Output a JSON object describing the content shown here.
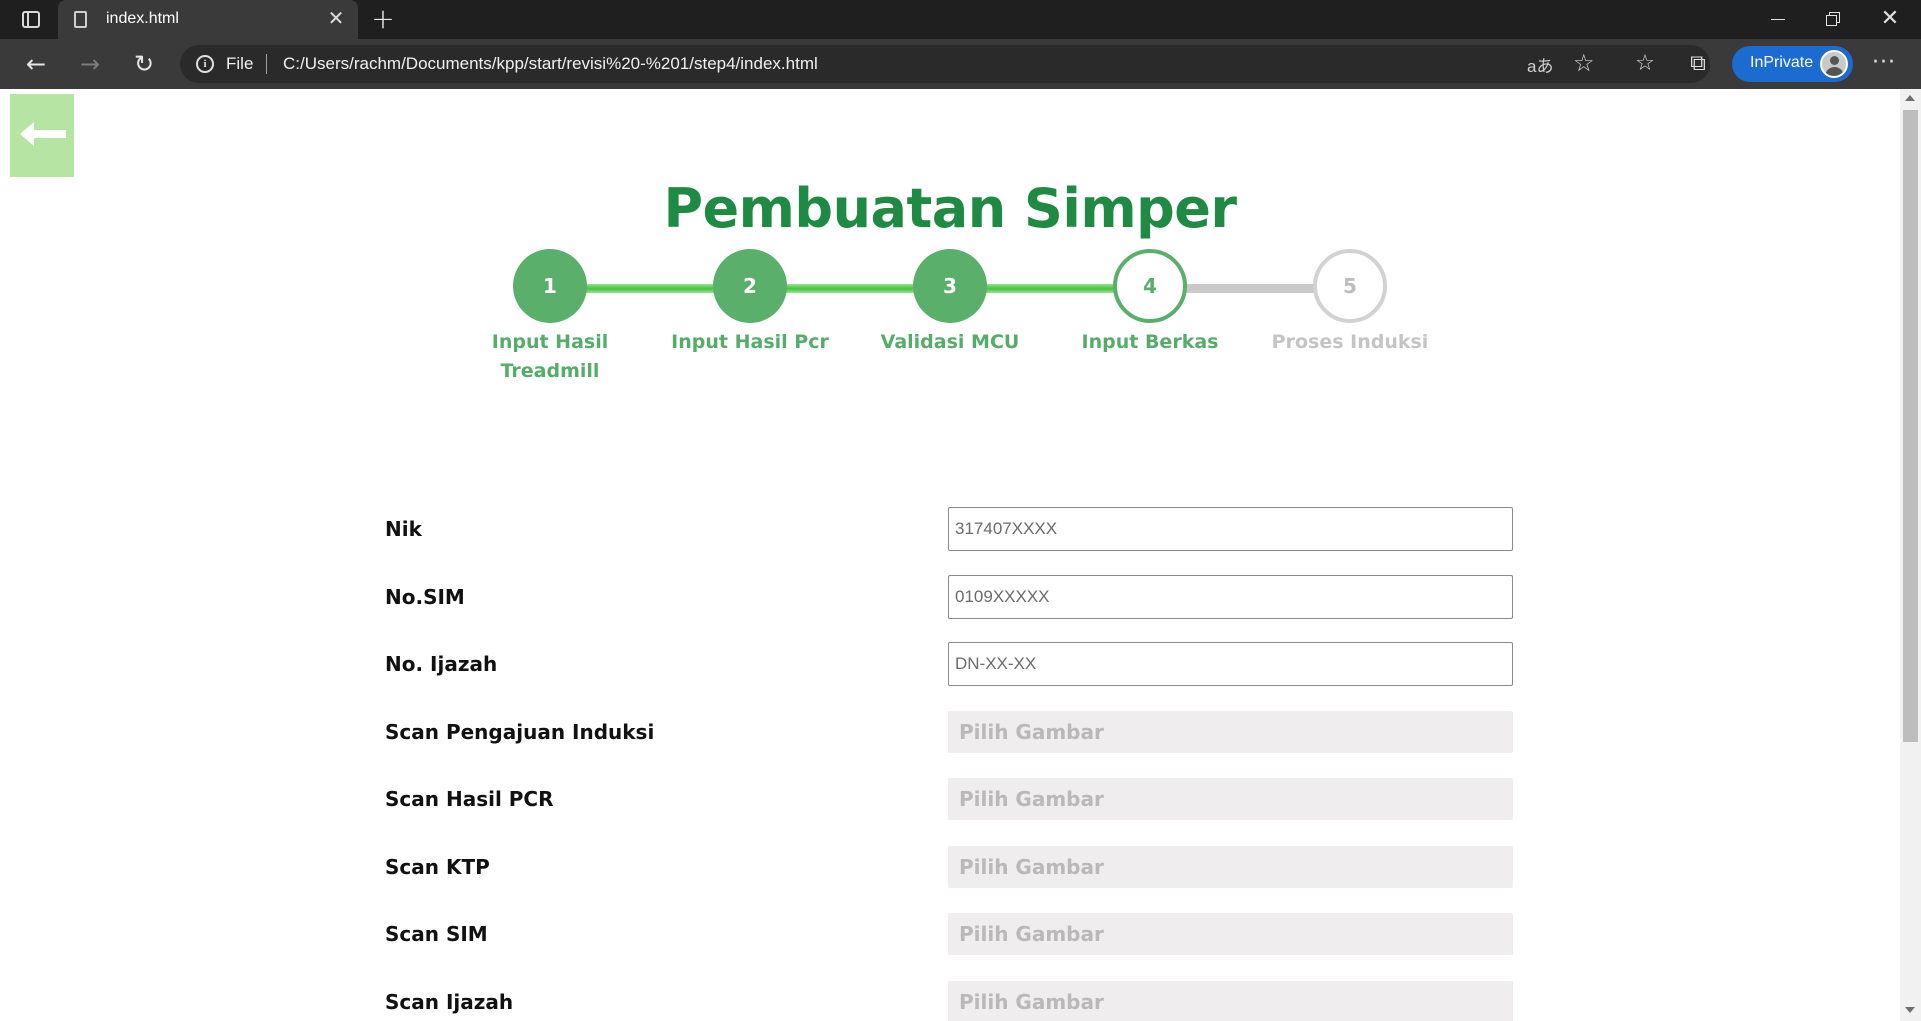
{
  "browser": {
    "tab_title": "index.html",
    "url_scheme": "File",
    "url": "C:/Users/rachm/Documents/kpp/start/revisi%20-%201/step4/index.html",
    "inprivate_label": "InPrivate",
    "read_aloud_glyph": "aあ"
  },
  "page": {
    "title": "Pembuatan Simper",
    "steps": [
      {
        "number": "1",
        "label": "Input Hasil Treadmill",
        "state": "done"
      },
      {
        "number": "2",
        "label": "Input Hasil Pcr",
        "state": "done"
      },
      {
        "number": "3",
        "label": "Validasi MCU",
        "state": "done"
      },
      {
        "number": "4",
        "label": "Input Berkas",
        "state": "active"
      },
      {
        "number": "5",
        "label": "Proses Induksi",
        "state": "todo"
      }
    ],
    "form": {
      "nik": {
        "label": "Nik",
        "placeholder": "317407XXXX"
      },
      "no_sim": {
        "label": "No.SIM",
        "placeholder": "0109XXXXX"
      },
      "no_ijazah": {
        "label": "No. Ijazah",
        "placeholder": "DN-XX-XX"
      },
      "scan_pengajuan": {
        "label": "Scan Pengajuan Induksi",
        "button": "Pilih Gambar"
      },
      "scan_pcr": {
        "label": "Scan Hasil PCR",
        "button": "Pilih Gambar"
      },
      "scan_ktp": {
        "label": "Scan KTP",
        "button": "Pilih Gambar"
      },
      "scan_sim": {
        "label": "Scan SIM",
        "button": "Pilih Gambar"
      },
      "scan_ijazah": {
        "label": "Scan Ijazah",
        "button": "Pilih Gambar"
      }
    }
  },
  "colors": {
    "brand_green": "#1e8a43",
    "step_green": "#5aaf6b",
    "back_button": "#b6e4a2",
    "inactive_gray": "#c8c8c8",
    "inprivate_blue": "#1b6bd0"
  }
}
